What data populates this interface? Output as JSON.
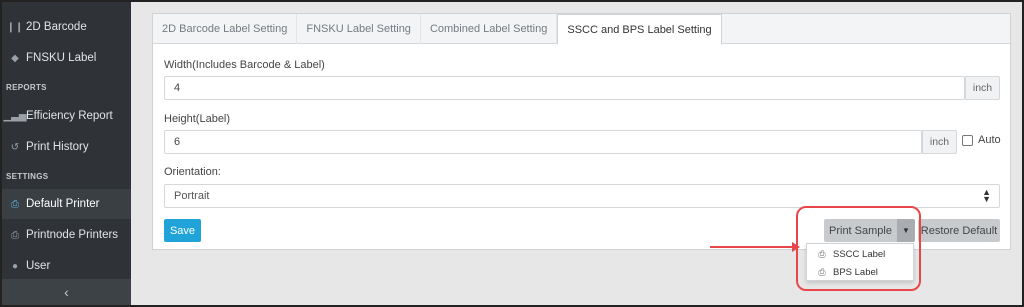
{
  "sidebar": {
    "items": [
      {
        "label": "2D Barcode",
        "icon": "barcode-icon",
        "glyph": "❙❙"
      },
      {
        "label": "FNSKU Label",
        "icon": "tag-icon",
        "glyph": "◆"
      },
      {
        "label": "Efficiency Report",
        "icon": "chart-icon",
        "glyph": "▁▃▅"
      },
      {
        "label": "Print History",
        "icon": "history-icon",
        "glyph": "↺"
      },
      {
        "label": "Default Printer",
        "icon": "printer-icon",
        "glyph": "⎙"
      },
      {
        "label": "Printnode Printers",
        "icon": "printer-icon",
        "glyph": "⎙"
      },
      {
        "label": "User",
        "icon": "user-icon",
        "glyph": "●"
      }
    ],
    "section_reports": "REPORTS",
    "section_settings": "SETTINGS",
    "collapse_glyph": "‹"
  },
  "tabs": [
    {
      "label": "2D Barcode Label Setting"
    },
    {
      "label": "FNSKU Label Setting"
    },
    {
      "label": "Combined Label Setting"
    },
    {
      "label": "SSCC and BPS Label Setting"
    }
  ],
  "form": {
    "width_label": "Width(Includes Barcode & Label)",
    "width_value": "4",
    "width_unit": "inch",
    "height_label": "Height(Label)",
    "height_value": "6",
    "height_unit": "inch",
    "auto_label": "Auto",
    "orientation_label": "Orientation:",
    "orientation_value": "Portrait"
  },
  "buttons": {
    "save": "Save",
    "print_sample": "Print Sample",
    "restore_default": "Restore Default"
  },
  "dropdown": {
    "items": [
      {
        "label": "SSCC Label"
      },
      {
        "label": "BPS Label"
      }
    ]
  },
  "colors": {
    "accent": "#1fa3d8",
    "sidebar_bg": "#2f3337",
    "highlight": "#e8474a"
  }
}
